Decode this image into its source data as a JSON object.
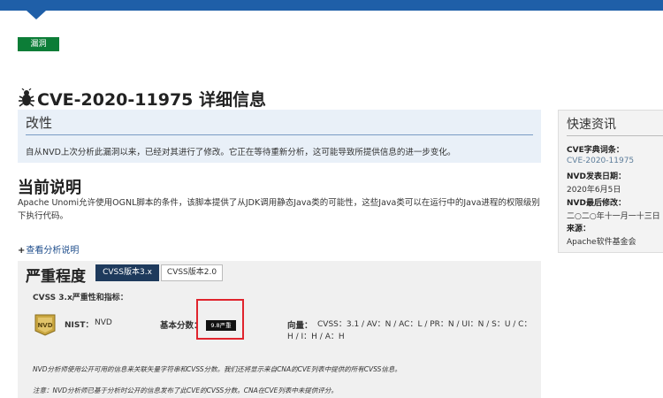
{
  "tag": "漏洞",
  "page_title": "CVE-2020-11975 详细信息",
  "change": {
    "title": "改性",
    "text": "自从NVD上次分析此漏洞以来，已经对其进行了修改。它正在等待重新分析，这可能导致所提供信息的进一步变化。"
  },
  "description": {
    "heading": "当前说明",
    "text": "Apache Unomi允许使用OGNL脚本的条件，该脚本提供了从JDK调用静态Java类的可能性，这些Java类可以在运行中的Java进程的权限级别下执行代码。"
  },
  "analysis_link": {
    "plus": "+",
    "label": "查看分析说明"
  },
  "severity": {
    "heading": "严重程度",
    "tab_v3": "CVSS版本3.x",
    "tab_v2": "CVSS版本2.0",
    "metrics_label": "CVSS 3.x严重性和指标：",
    "nist_label": "NIST：",
    "nist_value": "NVD",
    "base_label": "基本分数：",
    "score_badge": "9.8严重",
    "vector_label": "向量：",
    "vector_value": "CVSS：3.1 / AV：N / AC：L / PR：N / UI：N / S：U / C：H / I：H / A：H",
    "note1": "NVD分析师使用公开可用的信息来关联矢量字符串和CVSS分数。我们还将显示来自CNA的CVE列表中提供的所有CVSS信息。",
    "note2": "注意：NVD分析师已基于分析时公开的信息发布了此CVE的CVSS分数。CNA在CVE列表中未提供评分。"
  },
  "quick_info": {
    "title": "快速资讯",
    "dict_label": "CVE字典词条：",
    "dict_value": "CVE-2020-11975",
    "published_label": "NVD发表日期：",
    "published_value": "2020年6月5日",
    "modified_label": "NVD最后修改：",
    "modified_value": "二○二○年十一月一十三日",
    "source_label": "来源：",
    "source_value": "Apache软件基金会"
  },
  "colors": {
    "header_blue": "#1f5fa8",
    "tag_green": "#0c7d37",
    "active_tab": "#1e3a5c",
    "highlight_red": "#e0242d"
  }
}
